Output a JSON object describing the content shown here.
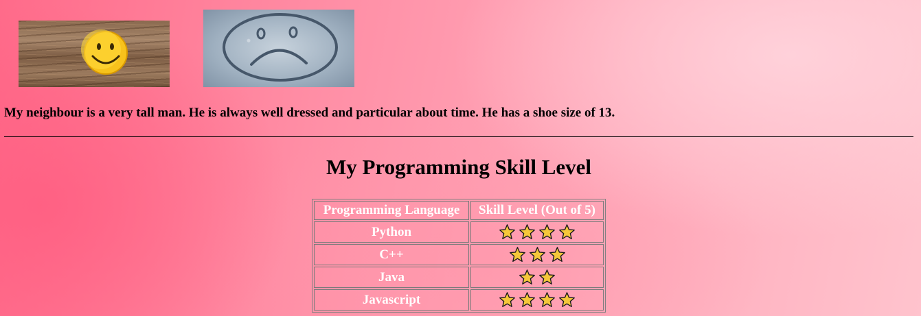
{
  "images": [
    {
      "name": "smiley-photo",
      "alt": "smiley face on wood"
    },
    {
      "name": "sad-face-photo",
      "alt": "sad face drawn in snow"
    }
  ],
  "neighbour_text": "My neighbour is a very tall man. He is always well dressed and particular about time. He has a shoe size of 13.",
  "skills": {
    "title": "My Programming Skill Level",
    "headers": [
      "Programming Language",
      "Skill Level (Out of 5)"
    ],
    "rows": [
      {
        "language": "Python",
        "stars": 4
      },
      {
        "language": "C++",
        "stars": 3
      },
      {
        "language": "Java",
        "stars": 2
      },
      {
        "language": "Javascript",
        "stars": 4
      }
    ],
    "star_icon": "star-icon",
    "star_color": "#f5c73a"
  }
}
